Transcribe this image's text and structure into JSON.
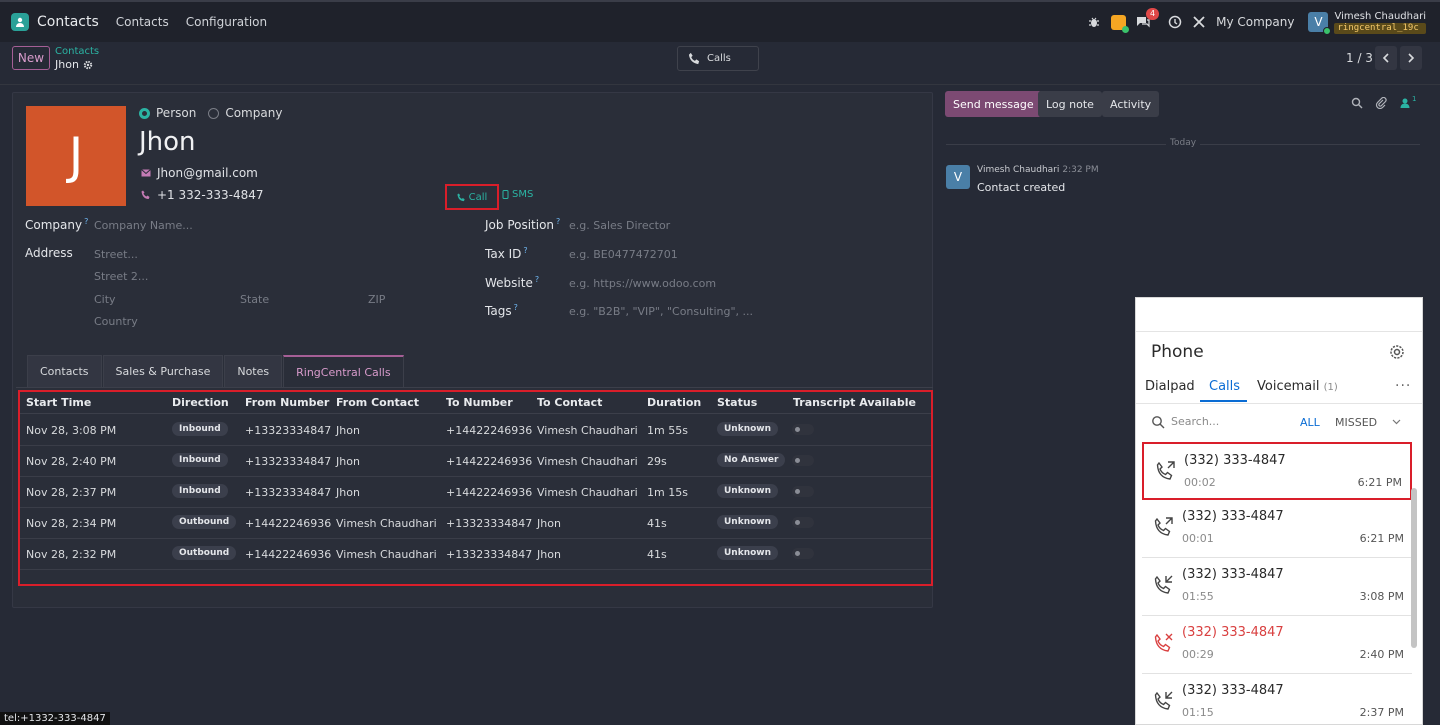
{
  "topnav": {
    "app_name": "Contacts",
    "menu": [
      "Contacts",
      "Configuration"
    ],
    "chat_badge": "4",
    "company": "My Company",
    "user_initial": "V",
    "user_name": "Vimesh Chaudhari",
    "user_db": "ringcentral_19c"
  },
  "control": {
    "new_label": "New",
    "breadcrumb_parent": "Contacts",
    "breadcrumb_current": "Jhon",
    "calls_label": "Calls",
    "pager": "1 / 3"
  },
  "form": {
    "avatar_letter": "J",
    "type_options": [
      "Person",
      "Company"
    ],
    "name": "Jhon",
    "email": "Jhon@gmail.com",
    "phone": "+1 332-333-4847",
    "call_label": "Call",
    "sms_label": "SMS",
    "company_label": "Company",
    "company_placeholder": "Company Name...",
    "address_label": "Address",
    "street_placeholder": "Street...",
    "street2_placeholder": "Street 2...",
    "city_placeholder": "City",
    "state_placeholder": "State",
    "zip_placeholder": "ZIP",
    "country_placeholder": "Country",
    "job_label": "Job Position",
    "job_placeholder": "e.g. Sales Director",
    "tax_label": "Tax ID",
    "tax_placeholder": "e.g. BE0477472701",
    "website_label": "Website",
    "website_placeholder": "e.g. https://www.odoo.com",
    "tags_label": "Tags",
    "tags_placeholder": "e.g. \"B2B\", \"VIP\", \"Consulting\", ...",
    "help_mark": "?"
  },
  "tabs": [
    "Contacts",
    "Sales & Purchase",
    "Notes",
    "RingCentral Calls"
  ],
  "calls_table": {
    "columns": [
      "Start Time",
      "Direction",
      "From Number",
      "From Contact",
      "To Number",
      "To Contact",
      "Duration",
      "Status",
      "Transcript Available"
    ],
    "rows": [
      {
        "start": "Nov 28, 3:08 PM",
        "direction": "Inbound",
        "from_number": "+13323334847",
        "from_contact": "Jhon",
        "to_number": "+14422246936",
        "to_contact": "Vimesh Chaudhari",
        "duration": "1m 55s",
        "status": "Unknown"
      },
      {
        "start": "Nov 28, 2:40 PM",
        "direction": "Inbound",
        "from_number": "+13323334847",
        "from_contact": "Jhon",
        "to_number": "+14422246936",
        "to_contact": "Vimesh Chaudhari",
        "duration": "29s",
        "status": "No Answer"
      },
      {
        "start": "Nov 28, 2:37 PM",
        "direction": "Inbound",
        "from_number": "+13323334847",
        "from_contact": "Jhon",
        "to_number": "+14422246936",
        "to_contact": "Vimesh Chaudhari",
        "duration": "1m 15s",
        "status": "Unknown"
      },
      {
        "start": "Nov 28, 2:34 PM",
        "direction": "Outbound",
        "from_number": "+14422246936",
        "from_contact": "Vimesh Chaudhari",
        "to_number": "+13323334847",
        "to_contact": "Jhon",
        "duration": "41s",
        "status": "Unknown"
      },
      {
        "start": "Nov 28, 2:32 PM",
        "direction": "Outbound",
        "from_number": "+14422246936",
        "from_contact": "Vimesh Chaudhari",
        "to_number": "+13323334847",
        "to_contact": "Jhon",
        "duration": "41s",
        "status": "Unknown"
      }
    ]
  },
  "chatter": {
    "send_message": "Send message",
    "log_note": "Log note",
    "activity": "Activity",
    "followers": "1",
    "today": "Today",
    "msg_initial": "V",
    "msg_author": "Vimesh Chaudhari",
    "msg_time": "2:32 PM",
    "msg_body": "Contact created"
  },
  "phone_widget": {
    "title": "Phone",
    "tabs": [
      "Dialpad",
      "Calls",
      "Voicemail"
    ],
    "voicemail_count": "(1)",
    "more": "···",
    "search_placeholder": "Search...",
    "filter_all": "ALL",
    "filter_missed": "MISSED",
    "calls": [
      {
        "number": "(332) 333-4847",
        "duration": "00:02",
        "time": "6:21 PM",
        "kind": "outgoing"
      },
      {
        "number": "(332) 333-4847",
        "duration": "00:01",
        "time": "6:21 PM",
        "kind": "outgoing"
      },
      {
        "number": "(332) 333-4847",
        "duration": "01:55",
        "time": "3:08 PM",
        "kind": "incoming"
      },
      {
        "number": "(332) 333-4847",
        "duration": "00:29",
        "time": "2:40 PM",
        "kind": "missed"
      },
      {
        "number": "(332) 333-4847",
        "duration": "01:15",
        "time": "2:37 PM",
        "kind": "incoming"
      }
    ]
  },
  "status_tip": "tel:+1332-333-4847"
}
